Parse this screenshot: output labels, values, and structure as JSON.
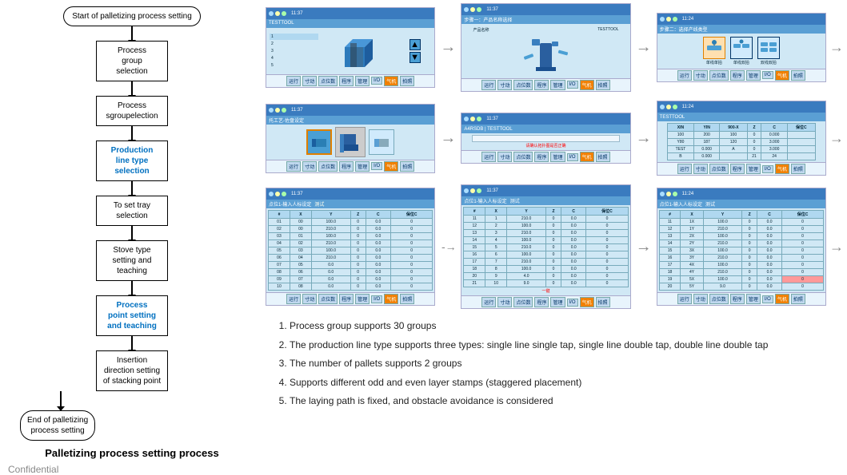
{
  "left": {
    "flow_title": "Palletizing process setting process",
    "confidential": "Confidential",
    "boxes": [
      {
        "id": "start",
        "label": "Start of palletizing\nprocess setting",
        "style": "rounded"
      },
      {
        "id": "process-group",
        "label": "Process\ngroup\nselection",
        "style": "normal"
      },
      {
        "id": "process-sgroup",
        "label": "Process\nsgroupelection",
        "style": "normal"
      },
      {
        "id": "production-line",
        "label": "Production\nline type\nselection",
        "style": "highlight"
      },
      {
        "id": "tray",
        "label": "To set tray\nselection",
        "style": "normal"
      },
      {
        "id": "stove",
        "label": "Stove type\nsetting and\nteaching",
        "style": "normal"
      },
      {
        "id": "process-point",
        "label": "Process\npoint setting\nand teaching",
        "style": "highlight"
      },
      {
        "id": "insertion",
        "label": "Insertion\ndirection setting\nof stacking point",
        "style": "normal"
      },
      {
        "id": "end",
        "label": "End of palletizing\nprocess setting",
        "style": "rounded"
      }
    ]
  },
  "screenshots": {
    "row1": [
      {
        "title": "TESTTOOL",
        "label": "Step 1: Product Name Selection",
        "type": "product-select"
      },
      {
        "title": "Step 2: Production Line Type",
        "label": "",
        "type": "line-type"
      },
      {
        "title": "Production line type",
        "label": "",
        "type": "line-type-options"
      }
    ],
    "row2": [
      {
        "title": "Process Work Area Settings",
        "label": "",
        "type": "work-area"
      },
      {
        "title": "A4RSDB",
        "label": "TESTTOOL",
        "type": "conveyor-layout"
      },
      {
        "title": "TESTTOOL",
        "label": "",
        "type": "data-table"
      }
    ],
    "row3": [
      {
        "title": "Point Input Settings",
        "label": "",
        "type": "point-table"
      },
      {
        "title": "Point Input Settings",
        "label": "",
        "type": "point-table2"
      },
      {
        "title": "Point Input Settings",
        "label": "",
        "type": "point-table3"
      }
    ]
  },
  "info": {
    "items": [
      "Process group supports 30 groups",
      "The production line type supports three types: single line single tap, single line double tap, double line double tap",
      "The number of pallets supports 2 groups",
      "Supports different odd and even layer stamps (staggered placement)",
      "The laying path is fixed, and obstacle avoidance is considered"
    ]
  },
  "footer_buttons": [
    "运行",
    "寸动",
    "点位数",
    "程序",
    "管理",
    "I/O",
    "气机",
    "拍照"
  ],
  "icons": {
    "arrow_right": "→",
    "arrow_down": "↓",
    "dashed_arrow": "- - →"
  }
}
